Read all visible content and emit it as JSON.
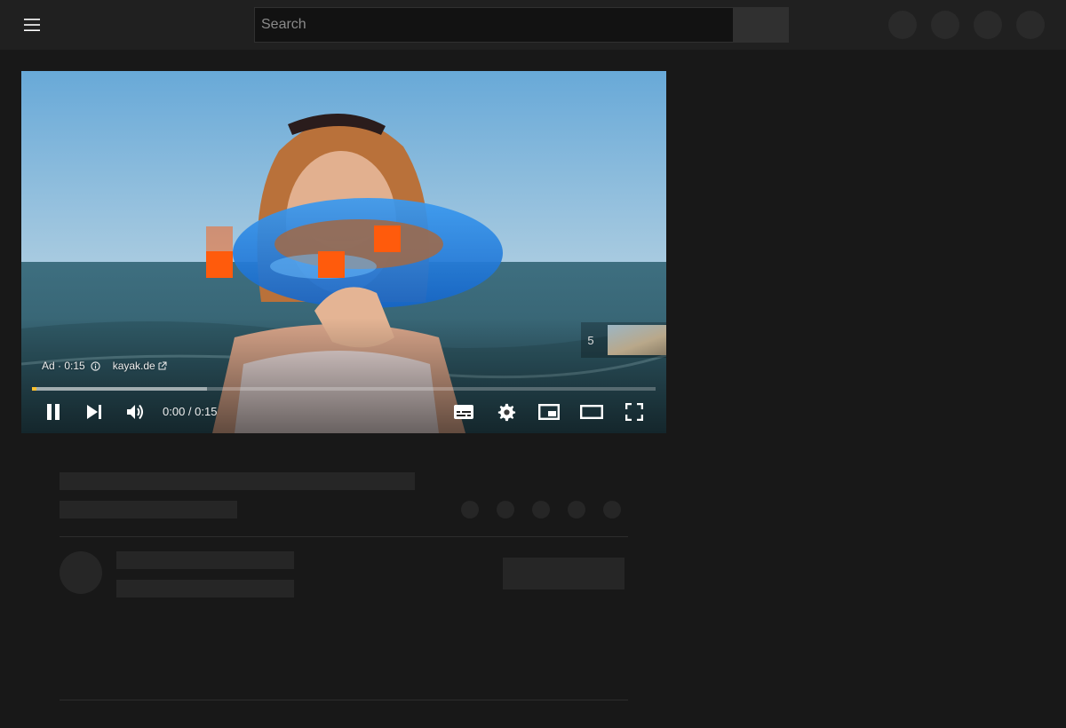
{
  "search": {
    "placeholder": "Search"
  },
  "player": {
    "ad_label": "Ad · 0:15",
    "advertiser": "kayak.de",
    "skip_countdown": "5",
    "time_display": "0:00 / 0:15",
    "progress_played": 0.002,
    "progress_buffered": 0.28,
    "accent_color": "#fbc02d"
  },
  "icons": {
    "menu": "menu-icon",
    "pause": "pause-icon",
    "next": "next-icon",
    "volume": "volume-icon",
    "subtitles": "subtitles-icon",
    "settings": "settings-icon",
    "miniplayer": "miniplayer-icon",
    "theater": "theater-icon",
    "fullscreen": "fullscreen-icon",
    "info": "info-icon",
    "external_link": "external-link-icon"
  }
}
